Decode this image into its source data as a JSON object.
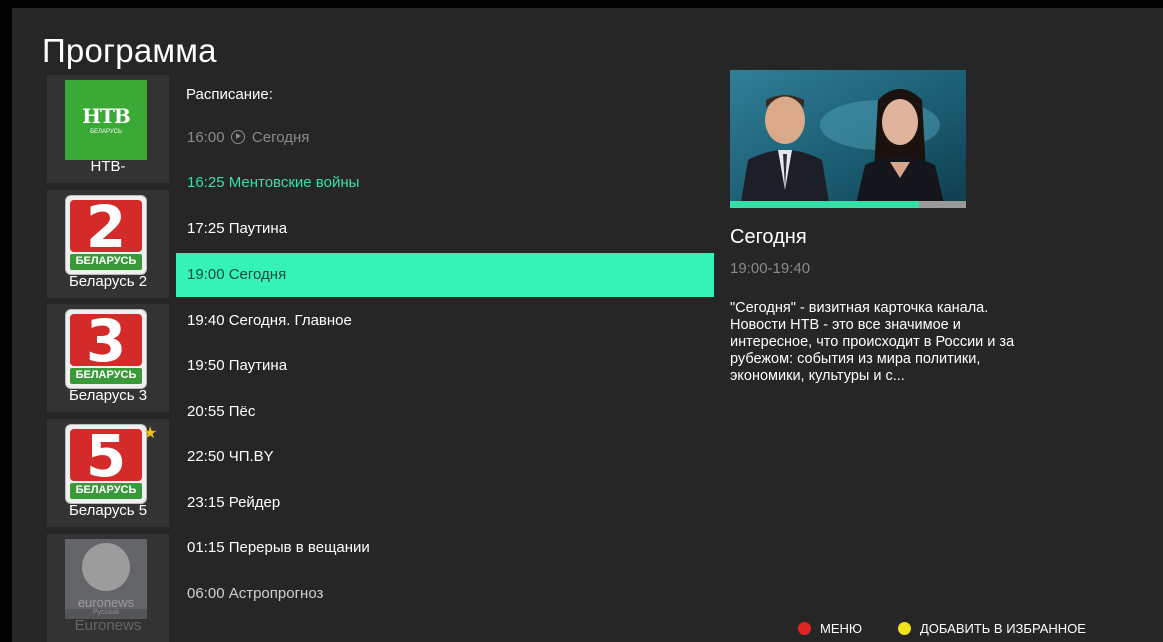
{
  "header": {
    "title": "Программа"
  },
  "channels": [
    {
      "name": "НТВ-",
      "logo_text": "НТВ",
      "logo_sub": "БЕЛАРУСЬ"
    },
    {
      "name": "Беларусь 2",
      "logo_digit": "2",
      "logo_band": "БЕЛАРУСЬ"
    },
    {
      "name": "Беларусь 3",
      "logo_digit": "3",
      "logo_band": "БЕЛАРУСЬ"
    },
    {
      "name": "Беларусь 5",
      "logo_digit": "5",
      "logo_band": "БЕЛАРУСЬ",
      "favorite": true
    },
    {
      "name": "Euronews",
      "logo_text": "euronews",
      "logo_sub": "Русский"
    }
  ],
  "schedule": {
    "label": "Расписание:",
    "items": [
      {
        "time": "16:00",
        "title": "Сегодня",
        "state": "past",
        "replay": true
      },
      {
        "time": "16:25",
        "title": "Ментовские войны",
        "state": "current"
      },
      {
        "time": "17:25",
        "title": "Паутина",
        "state": "future"
      },
      {
        "time": "19:00",
        "title": "Сегодня",
        "state": "selected"
      },
      {
        "time": "19:40",
        "title": "Сегодня. Главное",
        "state": "future"
      },
      {
        "time": "19:50",
        "title": "Паутина",
        "state": "future"
      },
      {
        "time": "20:55",
        "title": "Пёс",
        "state": "future"
      },
      {
        "time": "22:50",
        "title": "ЧП.BY",
        "state": "future"
      },
      {
        "time": "23:15",
        "title": "Рейдер",
        "state": "future"
      },
      {
        "time": "01:15",
        "title": "Перерыв в вещании",
        "state": "future"
      },
      {
        "time": "06:00",
        "title": "Астропрогноз",
        "state": "future"
      }
    ]
  },
  "details": {
    "title": "Сегодня",
    "time_range": "19:00-19:40",
    "description": "\"Сегодня\" - визитная карточка канала. Новости НТВ - это все значимое и интересное, что происходит в России и за рубежом: события из мира политики, экономики, культуры и с...",
    "progress": 0.8
  },
  "footer": {
    "menu_label": "МЕНЮ",
    "favorite_label": "ДОБАВИТЬ В ИЗБРАННОЕ",
    "menu_color": "#e02424",
    "favorite_color": "#f2e21b"
  },
  "colors": {
    "accent": "#35f2b7",
    "current": "#35e0a6",
    "background": "#262626"
  }
}
